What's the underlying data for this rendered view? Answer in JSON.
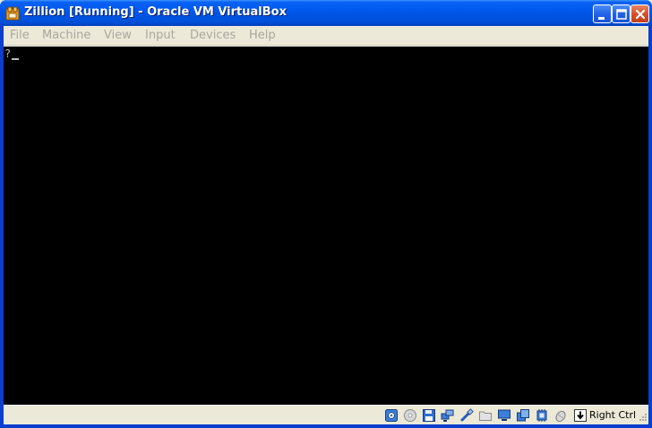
{
  "window": {
    "title": "Zillion [Running] - Oracle VM VirtualBox",
    "app_icon": "virtualbox-icon",
    "controls": [
      "minimize-icon",
      "maximize-icon",
      "close-icon"
    ]
  },
  "menubar": {
    "items": [
      {
        "label": "File"
      },
      {
        "label": "Machine"
      },
      {
        "label": "View"
      },
      {
        "label": "Input"
      },
      {
        "label": "Devices"
      },
      {
        "label": "Help"
      }
    ],
    "disabled_color": "#a9a79c"
  },
  "screen": {
    "console_text": "?",
    "background": "#000000",
    "text_color": "#bcbcbc"
  },
  "statusbar": {
    "indicators": [
      "hard-disk-icon",
      "optical-drive-icon",
      "floppy-icon",
      "network-icon",
      "usb-icon",
      "shared-folders-icon",
      "display-icon",
      "video-capture-icon",
      "cpu-virtualization-icon",
      "mouse-integration-icon",
      "keyboard-capture-icon"
    ],
    "host_key": "Right Ctrl"
  },
  "colors": {
    "titlebar": "#0054e3",
    "chrome": "#ece9d8",
    "close_button": "#d8502a"
  }
}
